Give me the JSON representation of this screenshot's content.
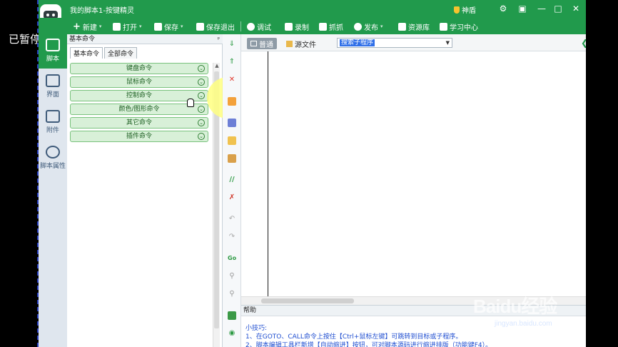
{
  "overlay": {
    "paused_text": "已暂停"
  },
  "window": {
    "title": "我的脚本1-按键精灵",
    "vip_label": "神盾",
    "min_label": "—",
    "max_label": "□",
    "close_label": "✕",
    "settings_label": "⚙",
    "restore_label": "▣"
  },
  "toolbar": {
    "new": "新建",
    "open": "打开",
    "save": "保存",
    "save_exit": "保存退出",
    "debug": "调试",
    "record": "录制",
    "capture": "抓抓",
    "publish": "发布",
    "resources": "资源库",
    "learning": "学习中心"
  },
  "leftnav": {
    "items": [
      {
        "label": "脚本",
        "icon": "code-icon",
        "active": true
      },
      {
        "label": "界面",
        "icon": "window-icon"
      },
      {
        "label": "附件",
        "icon": "attachment-icon"
      },
      {
        "label": "脚本属性",
        "icon": "info-icon"
      }
    ]
  },
  "cmd_panel": {
    "header": "基本命令",
    "pin": "ᵖ",
    "tabs": [
      "基本命令",
      "全部命令"
    ],
    "commands": [
      "键盘命令",
      "鼠标命令",
      "控制命令",
      "颜色/图形命令",
      "其它命令",
      "插件命令"
    ],
    "expand_glyph": "⌄"
  },
  "editor": {
    "mode_normal": "普通",
    "mode_source": "源文件",
    "select_value": "搜索子程序",
    "left_arrow": "❮",
    "right_arrow": "❯"
  },
  "help": {
    "header": "帮助",
    "line1": "小技巧:",
    "line2": "1、在GOTO、CALL命令上按住【Ctrl+鼠标左键】可跳转到目标或子程序。",
    "line3": "2、脚本编辑工具栏新增【自动缩进】按钮，可对脚本源码进行缩进排版（功能键F4）。"
  },
  "watermark": {
    "brand": "Baidu经验",
    "url": "jingyan.baidu.com"
  },
  "colors": {
    "brand_green": "#219a4c",
    "panel_bg": "#dfe6ee"
  }
}
